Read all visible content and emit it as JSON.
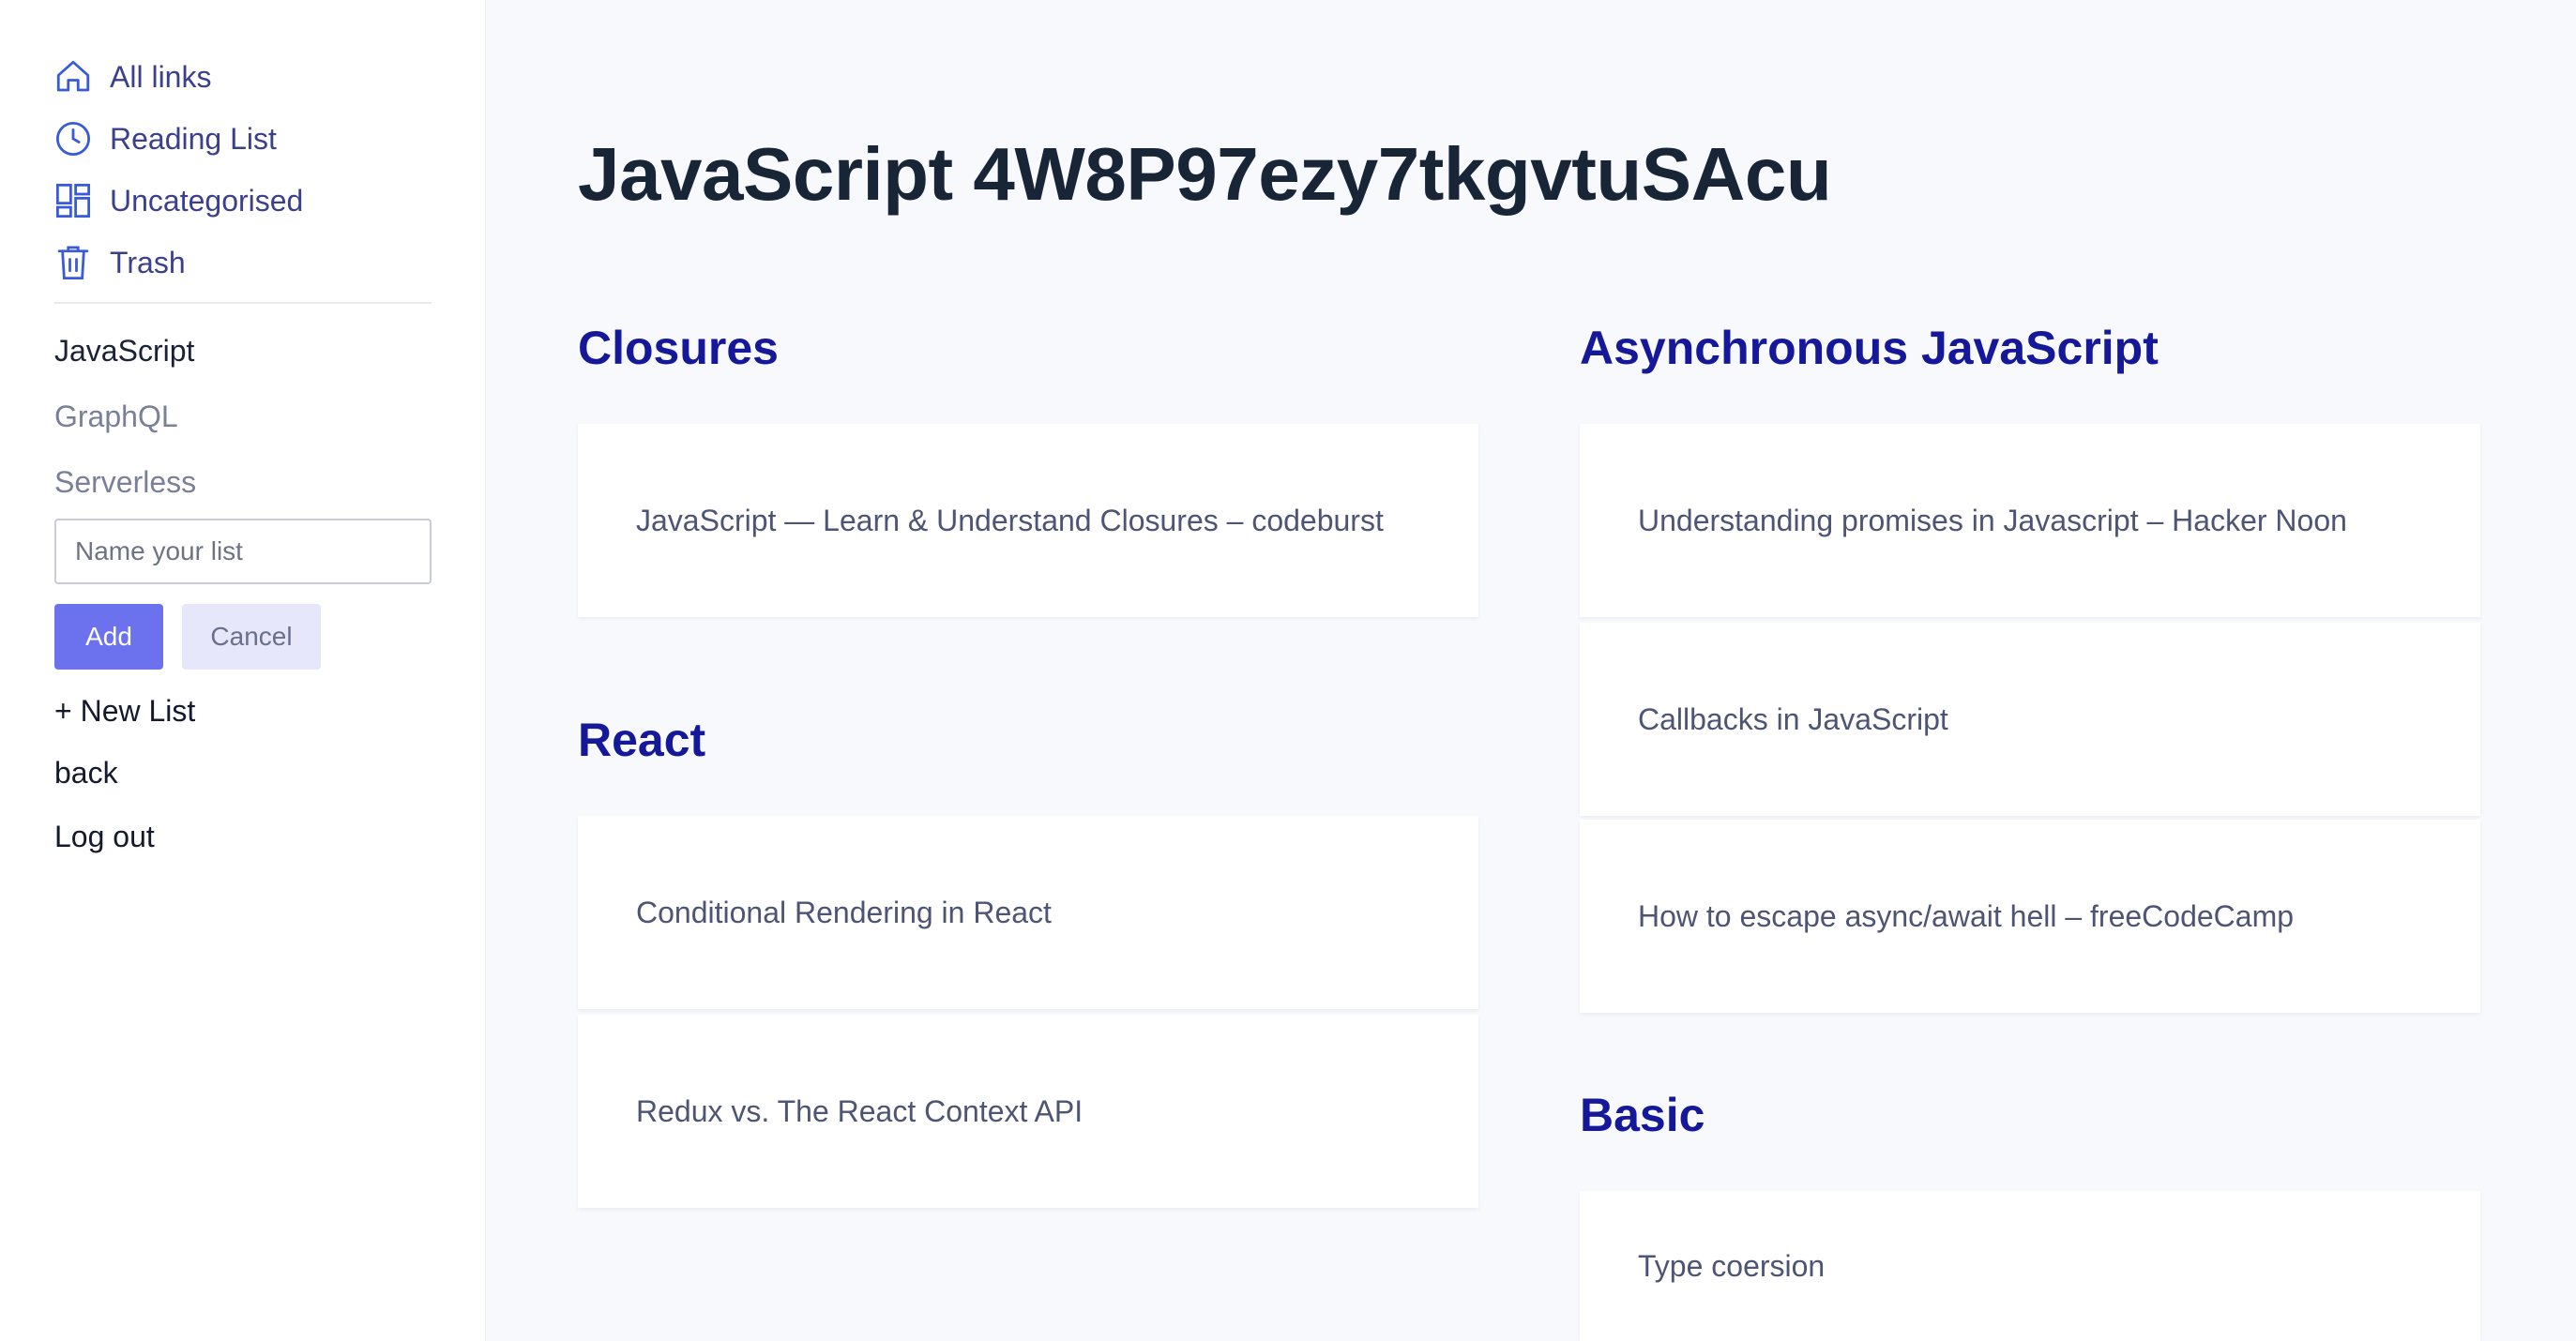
{
  "sidebar": {
    "nav": [
      {
        "label": "All links",
        "icon": "home-icon"
      },
      {
        "label": "Reading List",
        "icon": "clock-icon"
      },
      {
        "label": "Uncategorised",
        "icon": "grid-icon"
      },
      {
        "label": "Trash",
        "icon": "trash-icon"
      }
    ],
    "lists": [
      "JavaScript",
      "GraphQL",
      "Serverless"
    ],
    "new_list_input": {
      "placeholder": "Name your list",
      "value": ""
    },
    "add_label": "Add",
    "cancel_label": "Cancel",
    "new_list_label": "+ New List",
    "back_label": "back",
    "logout_label": "Log out"
  },
  "main": {
    "title": "JavaScript 4W8P97ezy7tkgvtuSAcu",
    "sections": [
      {
        "title": "Closures",
        "links": [
          "JavaScript — Learn & Understand Closures – codeburst"
        ]
      },
      {
        "title": "React",
        "links": [
          "Conditional Rendering in React",
          "Redux vs. The React Context API"
        ]
      },
      {
        "title": "Asynchronous JavaScript",
        "links": [
          "Understanding promises in Javascript – Hacker Noon",
          "Callbacks in JavaScript",
          "How to escape async/await hell – freeCodeCamp"
        ]
      },
      {
        "title": "Basic",
        "links": [
          "Type coersion"
        ]
      }
    ]
  },
  "colors": {
    "accent": "#6c72ee",
    "section_title": "#16189a",
    "nav_text": "#3b3f8c",
    "background": "#f8f9fd"
  }
}
